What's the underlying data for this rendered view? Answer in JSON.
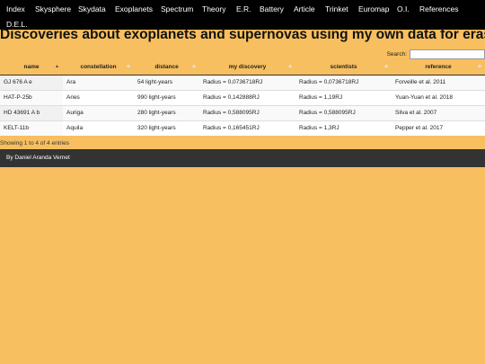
{
  "nav": {
    "items": [
      "Index",
      "Skysphere",
      "Skydata",
      "Exoplanets",
      "Spectrum",
      "Theory",
      "E.R.",
      "Battery",
      "Article",
      "Trinket",
      "Euromap",
      "O.I.",
      "References"
    ],
    "items_row2": [
      "D.E.L."
    ]
  },
  "page": {
    "title": "Discoveries about exoplanets and supernovas using my own data for erasmus+"
  },
  "search": {
    "label": "Search:",
    "value": ""
  },
  "table": {
    "columns": [
      "name",
      "constellation",
      "distance",
      "my discovery",
      "scientists",
      "reference"
    ],
    "sorted_column": "name",
    "rows": [
      [
        "GJ 676 A e",
        "Ara",
        "54 light-years",
        "Radius = 0,0736718RJ",
        "Radius = 0,0736718RJ",
        "Forveille et al. 2011"
      ],
      [
        "HAT-P-25b",
        "Aries",
        "990 light-years",
        "Radius = 0,142888RJ",
        "Radius = 1,19RJ",
        "Yuan-Yuan et al. 2018"
      ],
      [
        "HD 43691 A b",
        "Auriga",
        "280 light-years",
        "Radius = 0,588095RJ",
        "Radius = 0,588095RJ",
        "Silva et al. 2007"
      ],
      [
        "KELT-11b",
        "Aquila",
        "320 light-years",
        "Radius = 0,165451RJ",
        "Radius = 1,3RJ",
        "Pepper et al. 2017"
      ]
    ]
  },
  "table_info": "Showing 1 to 4 of 4 entries",
  "footer": {
    "text": "By Daniel Aranda Vernet"
  },
  "colors": {
    "background": "#f7bf5f",
    "nav": "#000000",
    "footer": "#333333"
  }
}
